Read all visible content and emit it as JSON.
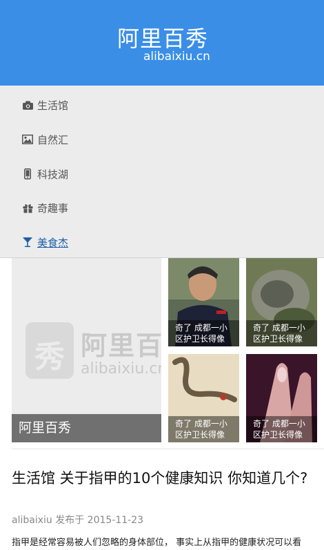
{
  "header": {
    "brand_cn": "阿里百秀",
    "brand_en": "alibaixiu.cn"
  },
  "menu": {
    "items": [
      {
        "label": "生活馆",
        "icon": "camera-icon"
      },
      {
        "label": "自然汇",
        "icon": "picture-icon"
      },
      {
        "label": "科技湖",
        "icon": "phone-icon"
      },
      {
        "label": "奇趣事",
        "icon": "gift-icon"
      },
      {
        "label": "美食杰",
        "icon": "glass-icon",
        "active": true
      }
    ]
  },
  "featured": {
    "big": {
      "logo_char": "秀",
      "logo_cn": "阿里百秀",
      "logo_en": "alibaixiu.cn",
      "caption": "阿里百秀"
    },
    "tiles": [
      {
        "caption": "奇了 成都一小区护卫长得像"
      },
      {
        "caption": "奇了 成都一小区护卫长得像"
      },
      {
        "caption": "奇了 成都一小区护卫长得像"
      },
      {
        "caption": "奇了 成都一小区护卫长得像"
      }
    ]
  },
  "article": {
    "title": "生活馆 关于指甲的10个健康知识 你知道几个?",
    "meta": "alibaixiu 发布于 2015-11-23",
    "excerpt": "指甲是经常容易被人们忽略的身体部位， 事实上从指甲的健康状况可以看"
  },
  "colors": {
    "header_bg": "#3a8ee6",
    "menu_bg": "#ececec",
    "active_link": "#1d5fa8"
  }
}
